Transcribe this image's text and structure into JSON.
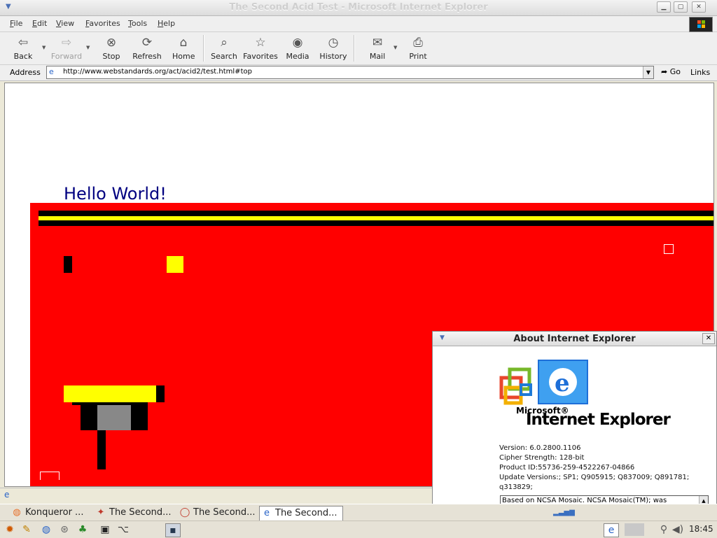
{
  "window": {
    "title": "The Second Acid Test - Microsoft Internet Explorer"
  },
  "menu": [
    "File",
    "Edit",
    "View",
    "Favorites",
    "Tools",
    "Help"
  ],
  "toolbar": {
    "back": "Back",
    "forward": "Forward",
    "stop": "Stop",
    "refresh": "Refresh",
    "home": "Home",
    "search": "Search",
    "favorites": "Favorites",
    "media": "Media",
    "history": "History",
    "mail": "Mail",
    "print": "Print"
  },
  "address": {
    "label": "Address",
    "url": "http://www.webstandards.org/act/acid2/test.html#top",
    "go": "Go",
    "links": "Links"
  },
  "page": {
    "heading": "Hello World!"
  },
  "about_dialog": {
    "title": "About Internet Explorer",
    "logo_microsoft": "Microsoft®",
    "logo_product": "Internet Explorer",
    "version": "Version: 6.0.2800.1106",
    "cipher": "Cipher Strength: 128-bit",
    "product_id": "Product ID:55736-259-4522267-04866",
    "update_versions": "Update Versions:; SP1; Q905915; Q837009; Q891781;",
    "update_versions_cont": "q313829;",
    "credits": "Based on NCSA Mosaic. NCSA Mosaic(TM); was"
  },
  "taskbar": {
    "tasks": [
      "Konqueror ...",
      "The Second...",
      "The Second...",
      "The Second..."
    ],
    "clock": "18:45"
  },
  "colors": {
    "acid_red": "#ff0000",
    "acid_yellow": "#ffff00",
    "heading_blue": "#000080"
  }
}
